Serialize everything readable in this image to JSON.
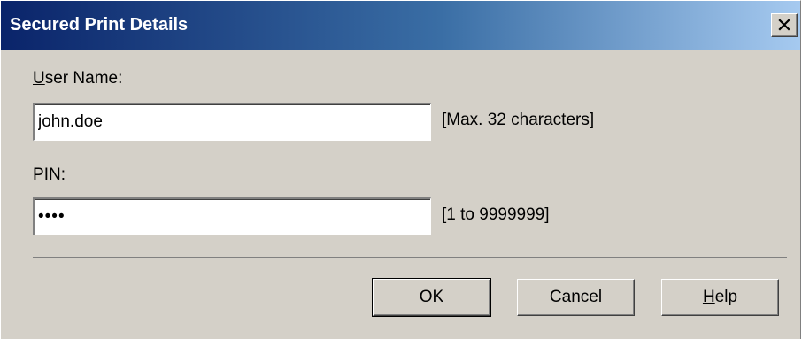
{
  "window": {
    "title": "Secured Print Details",
    "close_icon": "close-icon"
  },
  "form": {
    "user_name": {
      "label_accel": "U",
      "label_rest": "ser Name:",
      "value": "john.doe",
      "hint": "[Max. 32 characters]"
    },
    "pin": {
      "label_accel": "P",
      "label_rest": "IN:",
      "value": "1234",
      "hint": "[1 to 9999999]"
    }
  },
  "buttons": {
    "ok_label": "OK",
    "cancel_label": "Cancel",
    "help_accel": "H",
    "help_rest": "elp"
  },
  "colors": {
    "face": "#d4d0c8",
    "title_start": "#0a246a",
    "title_end": "#a6caf0"
  }
}
